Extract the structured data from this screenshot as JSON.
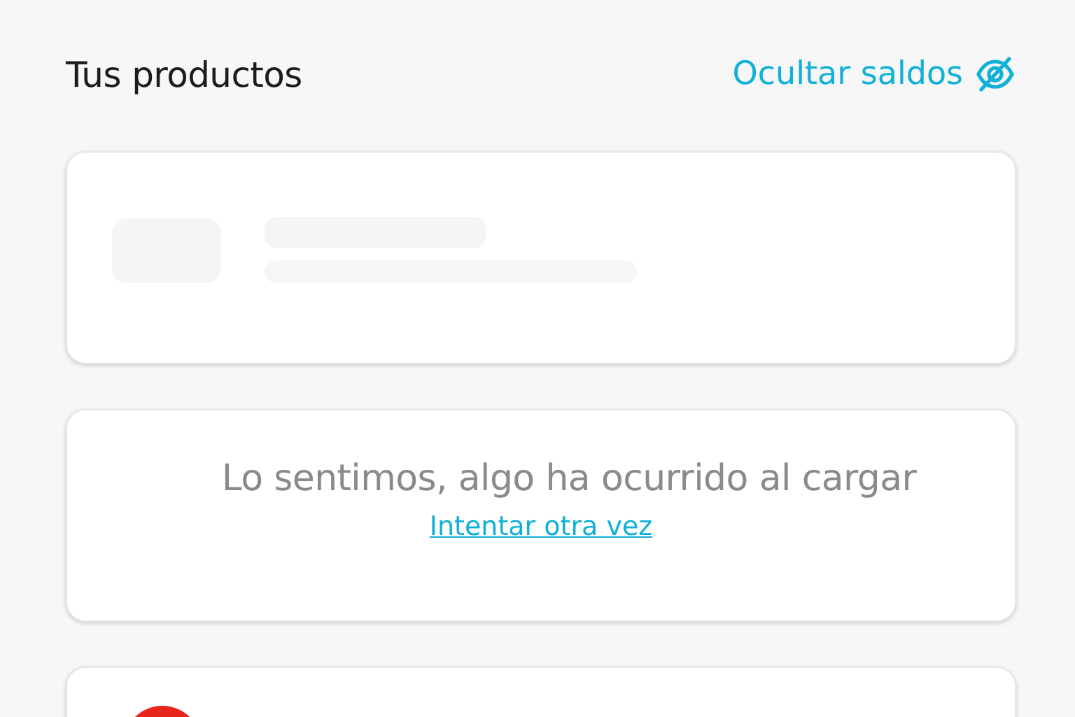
{
  "header": {
    "title": "Tus productos",
    "hide_balances_link": "Ocultar saldos"
  },
  "cards": [
    {
      "kind": "loading"
    },
    {
      "kind": "error",
      "message": "Lo sentimos, algo ha ocurrido al cargar",
      "retry_link": "Intentar otra vez"
    },
    {
      "kind": "product"
    }
  ]
}
